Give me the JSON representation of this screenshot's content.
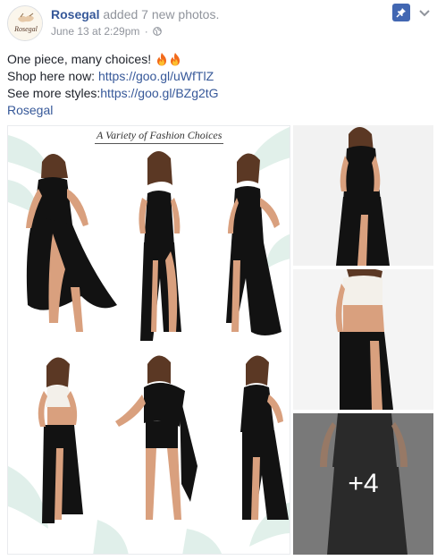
{
  "header": {
    "page_name": "Rosegal",
    "action_text": " added 7 new photos.",
    "timestamp": "June 13 at 2:29pm",
    "separator": "·",
    "avatar_text": "Rosegal",
    "privacy_icon": "globe-icon",
    "pin_icon": "pin-icon",
    "menu_icon": "chevron-down-icon"
  },
  "post": {
    "line1": "One piece, many choices! ",
    "line2_prefix": "Shop here now: ",
    "line2_link": "https://goo.gl/uWfTlZ",
    "line3_prefix": "See more styles:",
    "line3_link": "https://goo.gl/BZg2tG",
    "line4_link": "Rosegal",
    "emoji": "fire-emoji"
  },
  "photos": {
    "collage_title": "A Variety of Fashion Choices",
    "more_count": "+4"
  },
  "colors": {
    "link": "#365899",
    "meta": "#90949c",
    "text": "#1d2129",
    "pin": "#4267b2",
    "dress": "#121212",
    "skin": "#d9a07e"
  }
}
